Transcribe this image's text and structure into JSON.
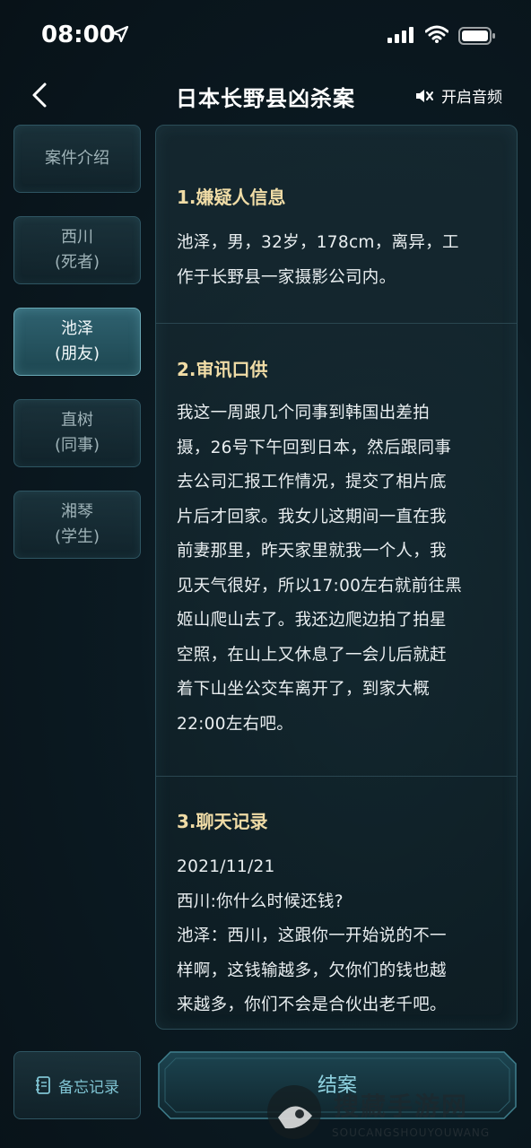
{
  "status": {
    "time": "08:00"
  },
  "header": {
    "title": "日本长野县凶杀案",
    "audio_label": "开启音频"
  },
  "sidebar": {
    "tabs": [
      {
        "line1": "案件介绍",
        "line2": ""
      },
      {
        "line1": "西川",
        "line2": "(死者)"
      },
      {
        "line1": "池泽",
        "line2": "(朋友)"
      },
      {
        "line1": "直树",
        "line2": "(同事)"
      },
      {
        "line1": "湘琴",
        "line2": "(学生)"
      }
    ],
    "active_index": 2
  },
  "content": {
    "sections": [
      {
        "title": "1.嫌疑人信息",
        "lines": [
          "池泽，男，32岁，178cm，离异，工",
          "作于长野县一家摄影公司内。"
        ]
      },
      {
        "title": "2.审讯口供",
        "lines": [
          "我这一周跟几个同事到韩国出差拍",
          "摄，26号下午回到日本，然后跟同事",
          "去公司汇报工作情况，提交了相片底",
          "片后才回家。我女儿这期间一直在我",
          "前妻那里，昨天家里就我一个人，我",
          "见天气很好，所以17:00左右就前往黑",
          "姬山爬山去了。我还边爬边拍了拍星",
          "空照，在山上又休息了一会儿后就赶",
          "着下山坐公交车离开了，到家大概",
          "22:00左右吧。"
        ]
      },
      {
        "title": "3.聊天记录",
        "lines": [
          "2021/11/21",
          "西川:你什么时候还钱?",
          "池泽：西川，这跟你一开始说的不一",
          "样啊，这钱输越多，欠你们的钱也越",
          "来越多，你们不会是合伙出老千吧。"
        ]
      }
    ]
  },
  "footer": {
    "memo_label": "备忘记录",
    "close_case_label": "结案"
  },
  "watermark": {
    "text": "搜藏手游网",
    "sub": "SOUCANGSHOUYOUWANG"
  },
  "colors": {
    "accent": "#8fd2e0",
    "section_title": "#f0dca6"
  }
}
